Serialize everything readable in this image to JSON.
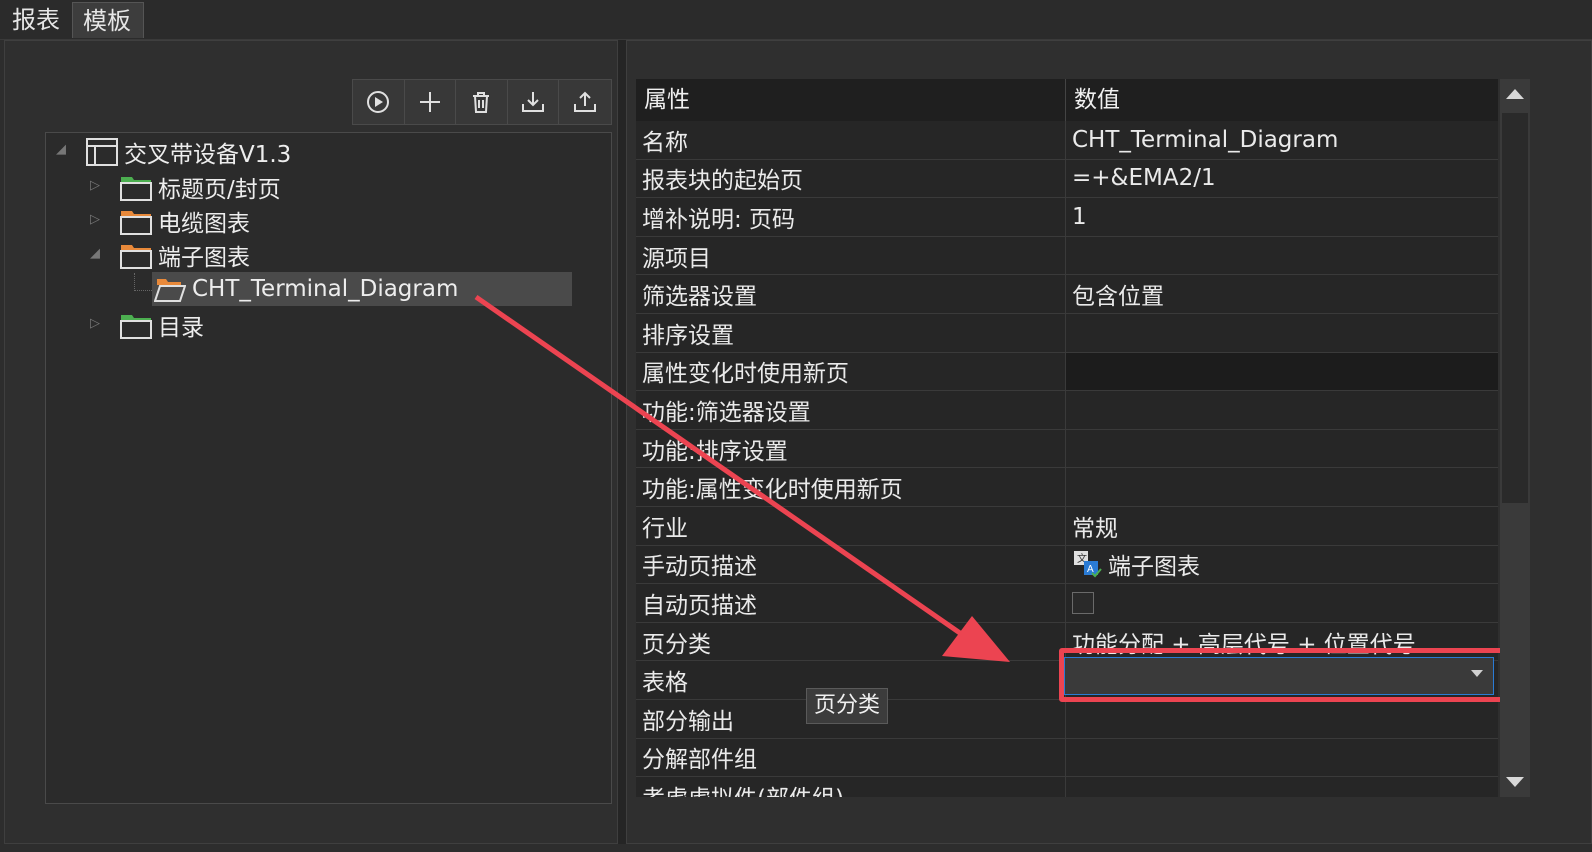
{
  "tabs": [
    "报表",
    "模板"
  ],
  "toolbar": {
    "icons": [
      "play-icon",
      "plus-icon",
      "trash-icon",
      "import-icon",
      "export-icon"
    ]
  },
  "tree": {
    "root": "交叉带设备V1.3",
    "items": [
      {
        "label": "标题页/封页",
        "folder_color": "#4caf50"
      },
      {
        "label": "电缆图表",
        "folder_color": "#e8893a"
      },
      {
        "label": "端子图表",
        "folder_color": "#e8893a"
      },
      {
        "label": "CHT_Terminal_Diagram",
        "folder_color": "#e8893a"
      },
      {
        "label": "目录",
        "folder_color": "#4caf50"
      }
    ]
  },
  "grid": {
    "header": {
      "key": "属性",
      "value": "数值"
    },
    "rows": [
      {
        "key": "名称",
        "value": "CHT_Terminal_Diagram"
      },
      {
        "key": "报表块的起始页",
        "value": "=+&EMA2/1"
      },
      {
        "key": "增补说明: 页码",
        "value": "1"
      },
      {
        "key": "源项目",
        "value": ""
      },
      {
        "key": "筛选器设置",
        "value": "包含位置"
      },
      {
        "key": "排序设置",
        "value": ""
      },
      {
        "key": "属性变化时使用新页",
        "value": ""
      },
      {
        "key": "功能:筛选器设置",
        "value": ""
      },
      {
        "key": "功能:排序设置",
        "value": ""
      },
      {
        "key": "功能:属性变化时使用新页",
        "value": ""
      },
      {
        "key": "行业",
        "value": "常规"
      },
      {
        "key": "手动页描述",
        "value": "端子图表"
      },
      {
        "key": "自动页描述",
        "value": ""
      },
      {
        "key": "页分类",
        "value": "功能分配 + 高层代号 + 位置代号"
      },
      {
        "key": "表格",
        "value": ""
      },
      {
        "key": "部分输出",
        "value": ""
      },
      {
        "key": "分解部件组",
        "value": ""
      },
      {
        "key": "考虑虚拟件(部件组)",
        "value": ""
      }
    ]
  },
  "tooltip": "页分类",
  "colors": {
    "accent_red": "#ec4451",
    "focus_blue": "#2a7bd5"
  }
}
